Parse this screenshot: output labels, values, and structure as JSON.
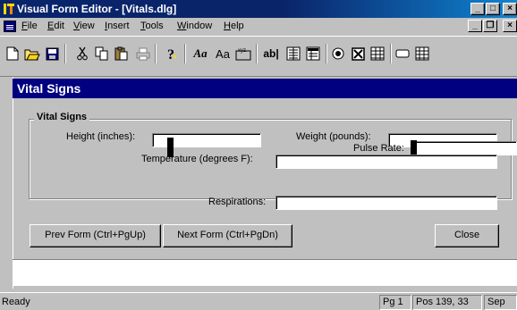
{
  "window": {
    "title": "Visual Form Editor - [Vitals.dlg]",
    "controls": {
      "minimize": "_",
      "maximize": "□",
      "close": "×"
    }
  },
  "menu": {
    "items": [
      "File",
      "Edit",
      "View",
      "Insert",
      "Tools",
      "Window",
      "Help"
    ],
    "mdi_controls": {
      "minimize": "_",
      "restore": "❐",
      "close": "×"
    }
  },
  "toolbar": {
    "italic_font": "Aa",
    "font": "Aa",
    "text_box": "ab|"
  },
  "form": {
    "title": "Vital Signs",
    "group_label": "Vital Signs",
    "fields": {
      "height_label": "Height (inches):",
      "weight_label": "Weight (pounds):",
      "pulse_label": "Pulse Rate:",
      "temperature_label": "Temperature (degrees F):",
      "respirations_label": "Respirations:"
    },
    "buttons": {
      "prev": "Prev Form (Ctrl+PgUp)",
      "next": "Next Form (Ctrl+PgDn)",
      "close": "Close"
    }
  },
  "status": {
    "ready": "Ready",
    "page": "Pg 1",
    "position": "Pos 139, 33",
    "sep": "Sep"
  },
  "colors": {
    "title_bar": "#0a246a",
    "form_header": "#000080",
    "face": "#c0c0c0"
  }
}
